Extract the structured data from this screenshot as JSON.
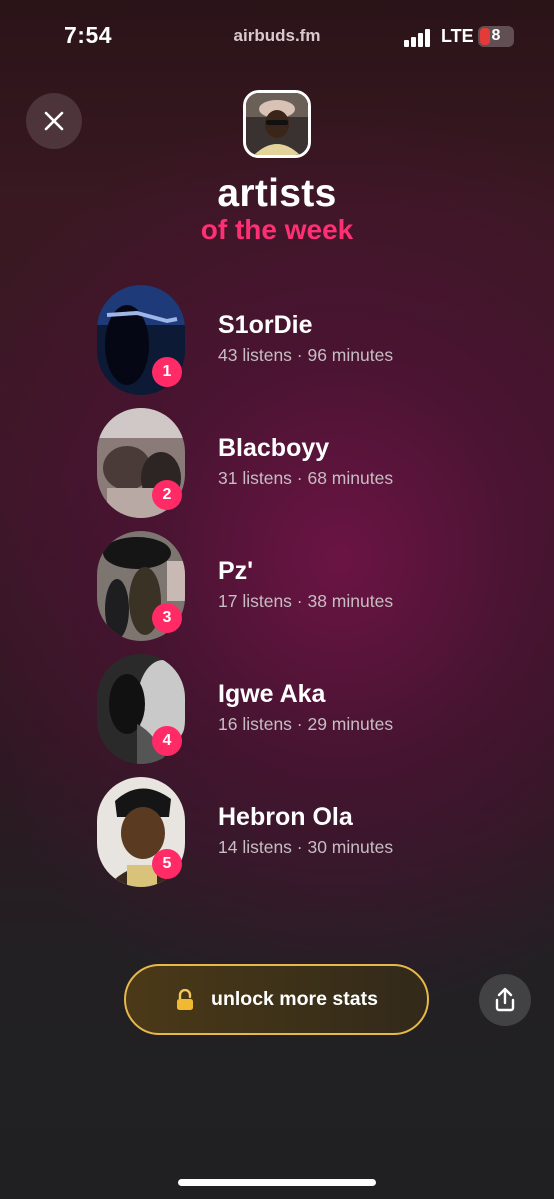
{
  "status_bar": {
    "time": "7:54",
    "url": "airbuds.fm",
    "network": "LTE",
    "battery": "8"
  },
  "header": {
    "title": "artists",
    "subtitle": "of the week"
  },
  "artists": [
    {
      "rank": "1",
      "name": "S1orDie",
      "stats": "43 listens · 96 minutes"
    },
    {
      "rank": "2",
      "name": "Blacboyy",
      "stats": "31 listens · 68 minutes"
    },
    {
      "rank": "3",
      "name": "Pz'",
      "stats": "17 listens · 38 minutes"
    },
    {
      "rank": "4",
      "name": "Igwe Aka",
      "stats": "16 listens · 29 minutes"
    },
    {
      "rank": "5",
      "name": "Hebron Ola",
      "stats": "14 listens · 30 minutes"
    }
  ],
  "actions": {
    "unlock_label": "unlock more stats"
  },
  "colors": {
    "accent_pink": "#ff2f74",
    "badge_pink": "#ff2a66",
    "gold_border": "#e7b84a"
  }
}
